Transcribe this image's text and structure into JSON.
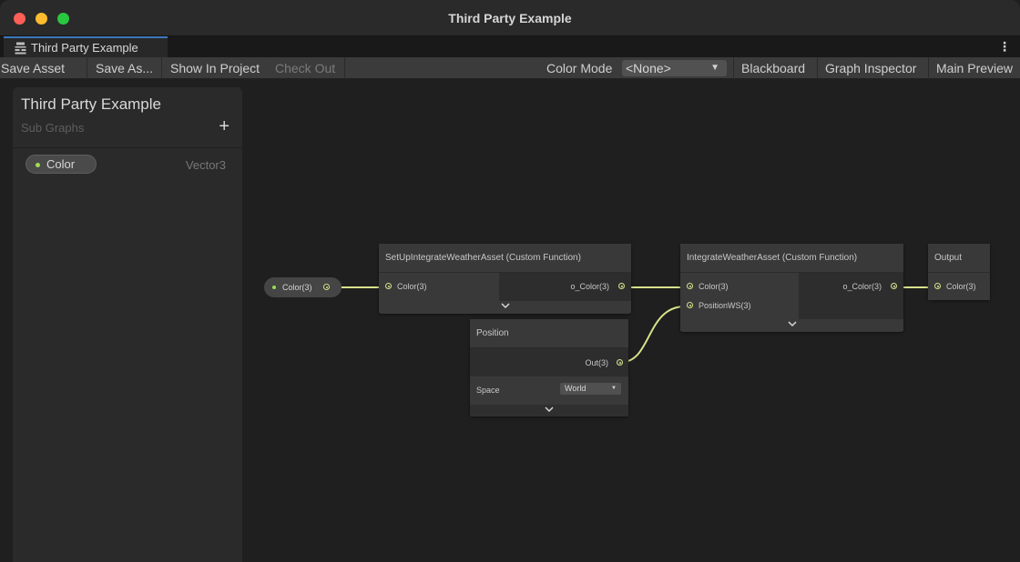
{
  "window": {
    "title": "Third Party Example"
  },
  "tab": {
    "label": "Third Party Example",
    "icon": "shader-graph-icon"
  },
  "toolbar": {
    "save_asset": "Save Asset",
    "save_as": "Save As...",
    "show_in_project": "Show In Project",
    "check_out": "Check Out",
    "color_mode_label": "Color Mode",
    "color_mode_value": "<None>",
    "blackboard": "Blackboard",
    "graph_inspector": "Graph Inspector",
    "main_preview": "Main Preview"
  },
  "blackboard": {
    "title": "Third Party Example",
    "subtitle": "Sub Graphs",
    "add_icon": "+",
    "properties": [
      {
        "name": "Color",
        "type": "Vector3"
      }
    ]
  },
  "nodes": {
    "color_property": {
      "label": "Color(3)"
    },
    "setup": {
      "title": "SetUpIntegrateWeatherAsset (Custom Function)",
      "input": "Color(3)",
      "output": "o_Color(3)"
    },
    "position": {
      "title": "Position",
      "output": "Out(3)",
      "space_label": "Space",
      "space_value": "World"
    },
    "integrate": {
      "title": "IntegrateWeatherAsset (Custom Function)",
      "input_color": "Color(3)",
      "input_position": "PositionWS(3)",
      "output": "o_Color(3)"
    },
    "output": {
      "title": "Output",
      "input": "Color(3)"
    }
  },
  "colors": {
    "wire": "#d9e28a",
    "accent_tab": "#3a79bb",
    "property_dot": "#9fdc52"
  }
}
